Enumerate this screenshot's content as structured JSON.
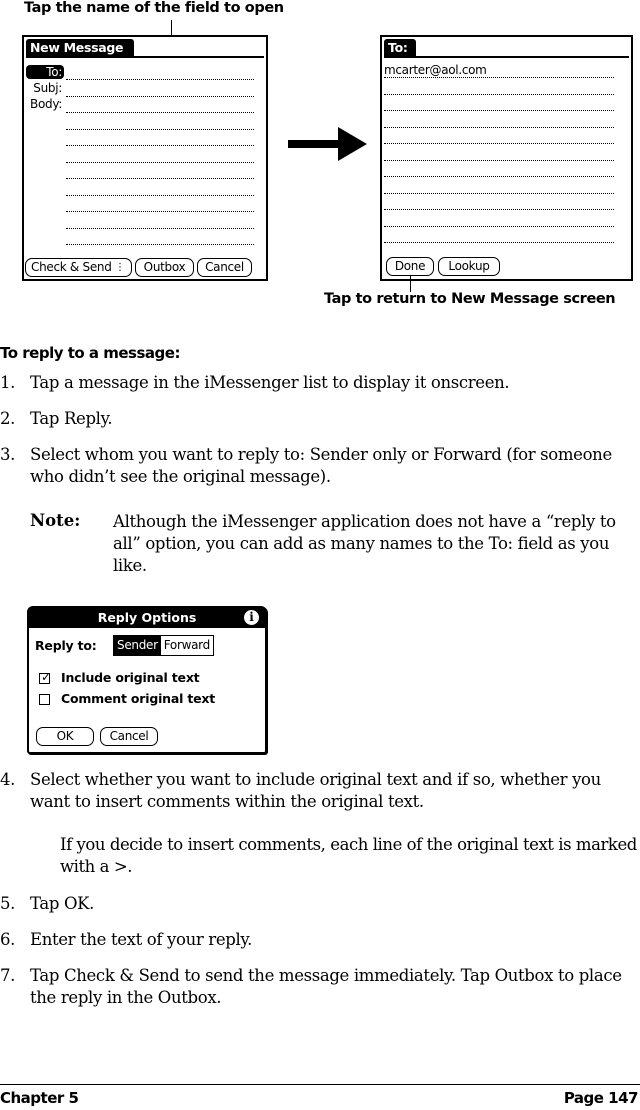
{
  "callouts": {
    "top": "Tap the name of the field to open",
    "bottom": "Tap to return to New Message screen"
  },
  "new_message_screen": {
    "title": "New Message",
    "fields": [
      {
        "label": "To:",
        "selected": true
      },
      {
        "label": "Subj:",
        "selected": false
      },
      {
        "label": "Body:",
        "selected": false
      }
    ],
    "buttons": {
      "check_send": "Check & Send",
      "outbox": "Outbox",
      "cancel": "Cancel"
    }
  },
  "to_screen": {
    "title": "To:",
    "value": "mcarter@aol.com",
    "buttons": {
      "done": "Done",
      "lookup": "Lookup"
    }
  },
  "icons": {
    "arrow": "right-arrow",
    "info": "i",
    "check": "✓",
    "status": "⋮"
  },
  "procedure": {
    "heading": "To reply to a message:",
    "steps": [
      {
        "num": "1.",
        "text": "Tap a message in the iMessenger list to display it onscreen."
      },
      {
        "num": "2.",
        "text": "Tap Reply."
      },
      {
        "num": "3.",
        "text": "Select whom you want to reply to: Sender only or Forward (for someone who didn’t see the original message)."
      },
      {
        "num": "4.",
        "text": "Select whether you want to include original text and if so, whether you want to insert comments within the original text."
      },
      {
        "num": "5.",
        "text": "Tap OK."
      },
      {
        "num": "6.",
        "text": "Enter the text of your reply."
      },
      {
        "num": "7.",
        "text": "Tap Check & Send to send the message immediately. Tap Outbox to place the reply in the Outbox."
      }
    ],
    "note": {
      "label": "Note:",
      "text": "Although the iMessenger application does not have a “reply to all” option, you can add as many names to the To: field as you like."
    },
    "step4_para": "If you decide to insert comments, each line of the original text is marked with a >."
  },
  "reply_dialog": {
    "title": "Reply Options",
    "reply_to_label": "Reply to:",
    "options": [
      {
        "label": "Sender",
        "selected": true
      },
      {
        "label": "Forward",
        "selected": false
      }
    ],
    "checkboxes": [
      {
        "label": "Include original text",
        "checked": true
      },
      {
        "label": "Comment original text",
        "checked": false
      }
    ],
    "buttons": {
      "ok": "OK",
      "cancel": "Cancel"
    }
  },
  "footer": {
    "chapter": "Chapter 5",
    "page": "Page 147"
  }
}
